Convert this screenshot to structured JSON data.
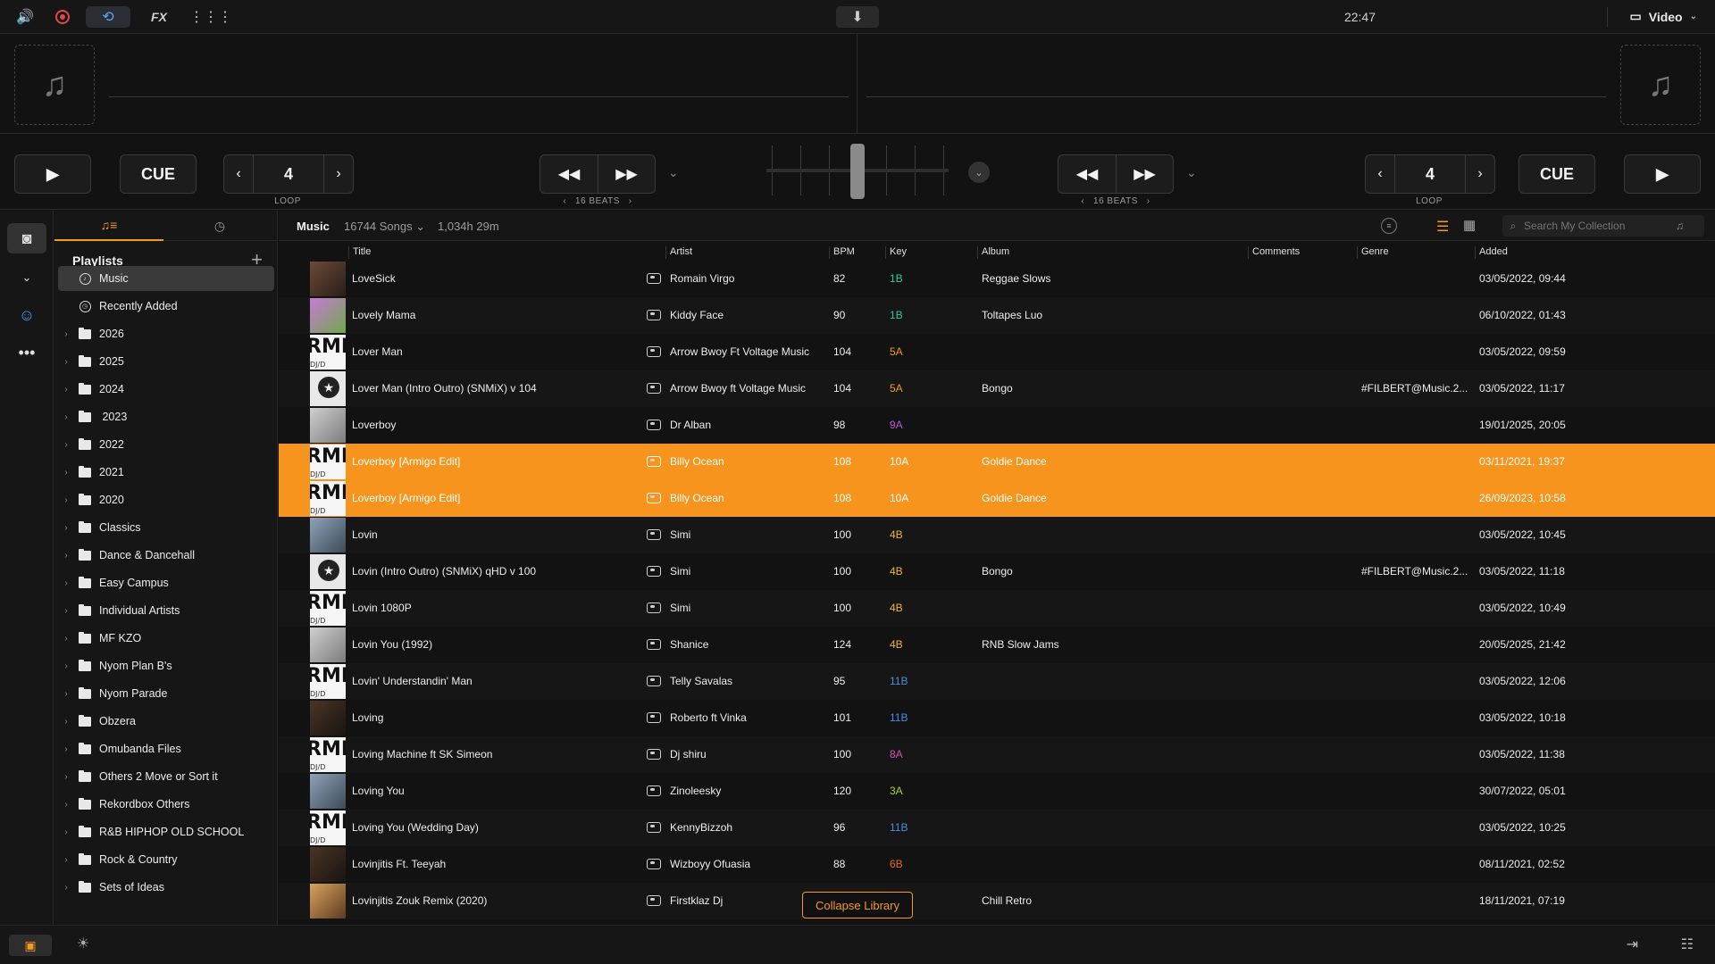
{
  "topbar": {
    "icons": [
      "volume-icon",
      "record-icon",
      "sync-icon",
      "fx-label",
      "grid-icon",
      "export-icon"
    ],
    "fx_label": "FX",
    "time": "22:47",
    "mode_label": "Video"
  },
  "decks": {
    "left": {
      "play": "▶",
      "cue": "CUE",
      "loop_value": "4",
      "loop_label": "LOOP",
      "beats_label": "16 BEATS"
    },
    "right": {
      "play": "▶",
      "cue": "CUE",
      "loop_value": "4",
      "loop_label": "LOOP",
      "beats_label": "16 BEATS"
    }
  },
  "sidebar": {
    "header": "Playlists",
    "items": [
      {
        "label": "Music",
        "icon": "music-icon",
        "active": true
      },
      {
        "label": "Recently Added",
        "icon": "clock-icon"
      },
      {
        "label": "2026",
        "icon": "folder-icon"
      },
      {
        "label": "2025",
        "icon": "folder-icon"
      },
      {
        "label": "2024",
        "icon": "folder-icon"
      },
      {
        "label": " 2023",
        "icon": "folder-icon"
      },
      {
        "label": "2022",
        "icon": "folder-icon"
      },
      {
        "label": "2021",
        "icon": "folder-icon"
      },
      {
        "label": "2020",
        "icon": "folder-icon"
      },
      {
        "label": "Classics",
        "icon": "folder-icon"
      },
      {
        "label": "Dance & Dancehall",
        "icon": "folder-icon"
      },
      {
        "label": "Easy Campus",
        "icon": "folder-icon"
      },
      {
        "label": "Individual Artists",
        "icon": "folder-icon"
      },
      {
        "label": "MF KZO",
        "icon": "folder-icon"
      },
      {
        "label": "Nyom Plan B's",
        "icon": "folder-icon"
      },
      {
        "label": "Nyom Parade",
        "icon": "folder-icon"
      },
      {
        "label": "Obzera",
        "icon": "folder-icon"
      },
      {
        "label": "Omubanda Files",
        "icon": "folder-icon"
      },
      {
        "label": "Others 2 Move or Sort it",
        "icon": "folder-icon"
      },
      {
        "label": "Rekordbox Others",
        "icon": "folder-icon"
      },
      {
        "label": "R&B HIPHOP OLD SCHOOL",
        "icon": "folder-icon"
      },
      {
        "label": "Rock & Country",
        "icon": "folder-icon"
      },
      {
        "label": "Sets of Ideas",
        "icon": "folder-icon"
      }
    ]
  },
  "library": {
    "title": "Music",
    "count": "16744 Songs ⌄",
    "duration": "1,034h 29m",
    "search_placeholder": "Search My Collection",
    "columns": [
      "Title",
      "Artist",
      "BPM",
      "Key",
      "Album",
      "Comments",
      "Genre",
      "Added"
    ],
    "rows": [
      {
        "title": "LoveSick",
        "artist": "Romain Virgo",
        "bpm": "82",
        "key": "1B",
        "key_color": "#2ec7a0",
        "album": "Reggae Slows",
        "genre": "",
        "added": "03/05/2022, 09:44",
        "thumb": "t-photo"
      },
      {
        "title": "Lovely Mama",
        "artist": "Kiddy Face",
        "bpm": "90",
        "key": "1B",
        "key_color": "#2ec7a0",
        "album": "Toltapes Luo",
        "genre": "",
        "added": "06/10/2022, 01:43",
        "thumb": "t-pink"
      },
      {
        "title": "Lover Man",
        "artist": "Arrow Bwoy Ft Voltage Music",
        "bpm": "104",
        "key": "5A",
        "key_color": "#f39a1e",
        "album": "",
        "genre": "",
        "added": "03/05/2022, 09:59",
        "thumb": "t-remix"
      },
      {
        "title": "Lover Man (Intro Outro) (SNMiX) v 104",
        "artist": "Arrow Bwoy ft Voltage Music",
        "bpm": "104",
        "key": "5A",
        "key_color": "#f39a1e",
        "album": "Bongo",
        "genre": "#FILBERT@Music.2...",
        "added": "03/05/2022, 11:17",
        "thumb": "t-badge"
      },
      {
        "title": "Loverboy",
        "artist": "Dr Alban",
        "bpm": "98",
        "key": "9A",
        "key_color": "#b55ad6",
        "album": "",
        "genre": "",
        "added": "19/01/2025, 20:05",
        "thumb": "t-grey"
      },
      {
        "title": "Loverboy [Armigo Edit]",
        "artist": "Billy Ocean",
        "bpm": "108",
        "key": "10A",
        "key_color": "#ffffff",
        "album": "Goldie Dance",
        "genre": "",
        "added": "03/11/2021, 19:37",
        "thumb": "t-remix",
        "selected": true
      },
      {
        "title": "Loverboy [Armigo Edit]",
        "artist": "Billy Ocean",
        "bpm": "108",
        "key": "10A",
        "key_color": "#ffffff",
        "album": "Goldie Dance",
        "genre": "",
        "added": "26/09/2023, 10:58",
        "thumb": "t-remix",
        "selected": true
      },
      {
        "title": "Lovin",
        "artist": "Simi",
        "bpm": "100",
        "key": "4B",
        "key_color": "#f2b233",
        "album": "",
        "genre": "",
        "added": "03/05/2022, 10:45",
        "thumb": "t-cool"
      },
      {
        "title": "Lovin (Intro Outro) (SNMiX) qHD v 100",
        "artist": "Simi",
        "bpm": "100",
        "key": "4B",
        "key_color": "#f2b233",
        "album": "Bongo",
        "genre": "#FILBERT@Music.2...",
        "added": "03/05/2022, 11:18",
        "thumb": "t-badge"
      },
      {
        "title": "Lovin 1080P",
        "artist": "Simi",
        "bpm": "100",
        "key": "4B",
        "key_color": "#f2b233",
        "album": "",
        "genre": "",
        "added": "03/05/2022, 10:49",
        "thumb": "t-remix"
      },
      {
        "title": "Lovin You (1992)",
        "artist": "Shanice",
        "bpm": "124",
        "key": "4B",
        "key_color": "#f2b233",
        "album": "RNB Slow Jams",
        "genre": "",
        "added": "20/05/2025, 21:42",
        "thumb": "t-grey"
      },
      {
        "title": "Lovin' Understandin' Man",
        "artist": "Telly Savalas",
        "bpm": "95",
        "key": "11B",
        "key_color": "#4a8fe0",
        "album": "",
        "genre": "",
        "added": "03/05/2022, 12:06",
        "thumb": "t-remix"
      },
      {
        "title": "Loving",
        "artist": "Roberto ft Vinka",
        "bpm": "101",
        "key": "11B",
        "key_color": "#4a8fe0",
        "album": "",
        "genre": "",
        "added": "03/05/2022, 10:18",
        "thumb": "t-dark"
      },
      {
        "title": "Loving Machine ft SK Simeon",
        "artist": "Dj shiru",
        "bpm": "100",
        "key": "8A",
        "key_color": "#d64fb4",
        "album": "",
        "genre": "",
        "added": "03/05/2022, 11:38",
        "thumb": "t-remix"
      },
      {
        "title": "Loving You",
        "artist": "Zinoleesky",
        "bpm": "120",
        "key": "3A",
        "key_color": "#a8d23a",
        "album": "",
        "genre": "",
        "added": "30/07/2022, 05:01",
        "thumb": "t-cool"
      },
      {
        "title": "Loving You (Wedding Day)",
        "artist": "KennyBizzoh",
        "bpm": "96",
        "key": "11B",
        "key_color": "#4a8fe0",
        "album": "",
        "genre": "",
        "added": "03/05/2022, 10:25",
        "thumb": "t-remix"
      },
      {
        "title": "Lovinjitis Ft. Teeyah",
        "artist": "Wizboyy Ofuasia",
        "bpm": "88",
        "key": "6B",
        "key_color": "#e8642a",
        "album": "",
        "genre": "",
        "added": "08/11/2021, 02:52",
        "thumb": "t-dark"
      },
      {
        "title": "Lovinjitis Zouk Remix (2020)",
        "artist": "Firstklaz Dj",
        "bpm": "",
        "key": "",
        "key_color": "#ffffff",
        "album": "Chill Retro",
        "genre": "",
        "added": "18/11/2021, 07:19",
        "thumb": "t-warm"
      }
    ]
  },
  "collapse_label": "Collapse Library",
  "colors": {
    "accent": "#f7941d",
    "selection": "#f7941d",
    "background": "#121212"
  }
}
